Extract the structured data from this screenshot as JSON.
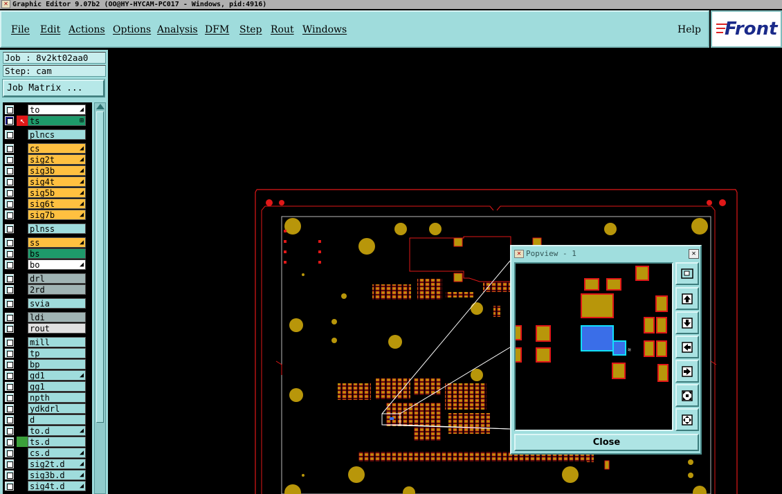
{
  "window": {
    "title": "Graphic Editor 9.07b2  (OO@HY-HYCAM-PC017 - Windows, pid:4916)"
  },
  "menu": {
    "file": "File",
    "edit": "Edit",
    "actions": "Actions",
    "options": "Options",
    "analysis": "Analysis",
    "dfm": "DFM",
    "step": "Step",
    "rout": "Rout",
    "windows": "Windows",
    "help": "Help"
  },
  "logo": {
    "text": "Front"
  },
  "job": {
    "line": "Job : 8v2kt02aa0",
    "step": "Step: cam",
    "matrix_button": "Job Matrix ..."
  },
  "layers": [
    {
      "name": "to",
      "color": "#ffffff",
      "mark": "◢",
      "affected": false
    },
    {
      "name": "ts",
      "color": "#1e9a6a",
      "mark": "⊞",
      "affected": true,
      "active": true
    },
    {
      "name": "plncs",
      "color": "#9fdcdc",
      "mark": "",
      "affected": false
    },
    {
      "name": "cs",
      "color": "#ffc040",
      "mark": "◢",
      "affected": false
    },
    {
      "name": "sig2t",
      "color": "#ffc040",
      "mark": "◢",
      "affected": false
    },
    {
      "name": "sig3b",
      "color": "#ffc040",
      "mark": "◢",
      "affected": false
    },
    {
      "name": "sig4t",
      "color": "#ffc040",
      "mark": "◢",
      "affected": false
    },
    {
      "name": "sig5b",
      "color": "#ffc040",
      "mark": "◢",
      "affected": false
    },
    {
      "name": "sig6t",
      "color": "#ffc040",
      "mark": "◢",
      "affected": false
    },
    {
      "name": "sig7b",
      "color": "#ffc040",
      "mark": "◢",
      "affected": false
    },
    {
      "name": "plnss",
      "color": "#9fdcdc",
      "mark": "",
      "affected": false
    },
    {
      "name": "ss",
      "color": "#ffc040",
      "mark": "◢",
      "affected": false
    },
    {
      "name": "bs",
      "color": "#1e9a6a",
      "mark": "",
      "affected": false
    },
    {
      "name": "bo",
      "color": "#ffffff",
      "mark": "◢",
      "affected": false
    },
    {
      "name": "drl",
      "color": "#a0b4b4",
      "mark": "",
      "affected": false
    },
    {
      "name": "2rd",
      "color": "#a0b4b4",
      "mark": "",
      "affected": false
    },
    {
      "name": "svia",
      "color": "#9fdcdc",
      "mark": "",
      "affected": false
    },
    {
      "name": "ldi",
      "color": "#a0b4b4",
      "mark": "",
      "affected": false
    },
    {
      "name": "rout",
      "color": "#e0e0e0",
      "mark": "",
      "affected": false
    },
    {
      "name": "mill",
      "color": "#9fdcdc",
      "mark": "",
      "affected": false
    },
    {
      "name": "tp",
      "color": "#9fdcdc",
      "mark": "",
      "affected": false
    },
    {
      "name": "bp",
      "color": "#9fdcdc",
      "mark": "",
      "affected": false
    },
    {
      "name": "gd1",
      "color": "#9fdcdc",
      "mark": "◢",
      "affected": false
    },
    {
      "name": "gg1",
      "color": "#9fdcdc",
      "mark": "",
      "affected": false
    },
    {
      "name": "npth",
      "color": "#9fdcdc",
      "mark": "",
      "affected": false
    },
    {
      "name": "ydkdrl",
      "color": "#9fdcdc",
      "mark": "",
      "affected": false
    },
    {
      "name": "d",
      "color": "#9fdcdc",
      "mark": "",
      "affected": false
    },
    {
      "name": "to.d",
      "color": "#9fdcdc",
      "mark": "◢",
      "affected": false
    },
    {
      "name": "ts.d",
      "color": "#9fdcdc",
      "mark": "",
      "affected": false,
      "green": true
    },
    {
      "name": "cs.d",
      "color": "#9fdcdc",
      "mark": "◢",
      "affected": false
    },
    {
      "name": "sig2t.d",
      "color": "#9fdcdc",
      "mark": "◢",
      "affected": false
    },
    {
      "name": "sig3b.d",
      "color": "#9fdcdc",
      "mark": "◢",
      "affected": false
    },
    {
      "name": "sig4t.d",
      "color": "#9fdcdc",
      "mark": "◢",
      "affected": false
    }
  ],
  "popview": {
    "title": "Popview - 1",
    "close_x": "✕",
    "close_button": "Close"
  },
  "colors": {
    "panel": "#9fdcdc",
    "pad": "#b8960a",
    "outline": "#e01818",
    "highlight": "#3a6ee8"
  }
}
